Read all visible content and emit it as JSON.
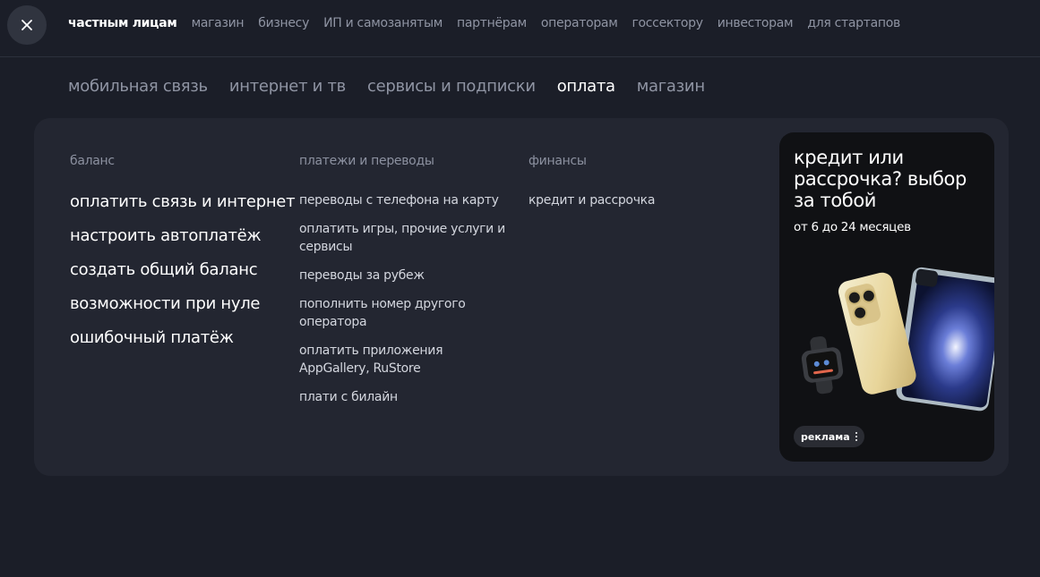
{
  "top_nav": {
    "items": [
      {
        "label": "частным лицам",
        "active": true
      },
      {
        "label": "магазин"
      },
      {
        "label": "бизнесу"
      },
      {
        "label": "ИП и самозанятым"
      },
      {
        "label": "партнёрам"
      },
      {
        "label": "операторам"
      },
      {
        "label": "госсектору"
      },
      {
        "label": "инвесторам"
      },
      {
        "label": "для стартапов"
      }
    ]
  },
  "sub_nav": {
    "items": [
      {
        "label": "мобильная связь"
      },
      {
        "label": "интернет и тв"
      },
      {
        "label": "сервисы и подписки"
      },
      {
        "label": "оплата",
        "active": true
      },
      {
        "label": "магазин"
      }
    ]
  },
  "menu": {
    "balance": {
      "title": "баланс",
      "links": [
        "оплатить связь и интернет",
        "настроить автоплатёж",
        "создать общий баланс",
        "возможности при нуле",
        "ошибочный платёж"
      ]
    },
    "payments": {
      "title": "платежи и переводы",
      "links": [
        "переводы с телефона на карту",
        "оплатить игры, прочие услуги и сервисы",
        "переводы за рубеж",
        "пополнить номер другого оператора",
        "оплатить приложения AppGallery, RuStore",
        "плати с билайн"
      ]
    },
    "finance": {
      "title": "финансы",
      "links": [
        "кредит и рассрочка"
      ]
    }
  },
  "promo": {
    "title": "кредит или рассрочка? выбор за тобой",
    "subtitle": "от 6 до 24 месяцев",
    "ad_label": "реклама"
  },
  "colors": {
    "background": "#1b1e28",
    "panel": "#232631",
    "promo_bg": "#101114",
    "muted_text": "#8f94a3"
  }
}
